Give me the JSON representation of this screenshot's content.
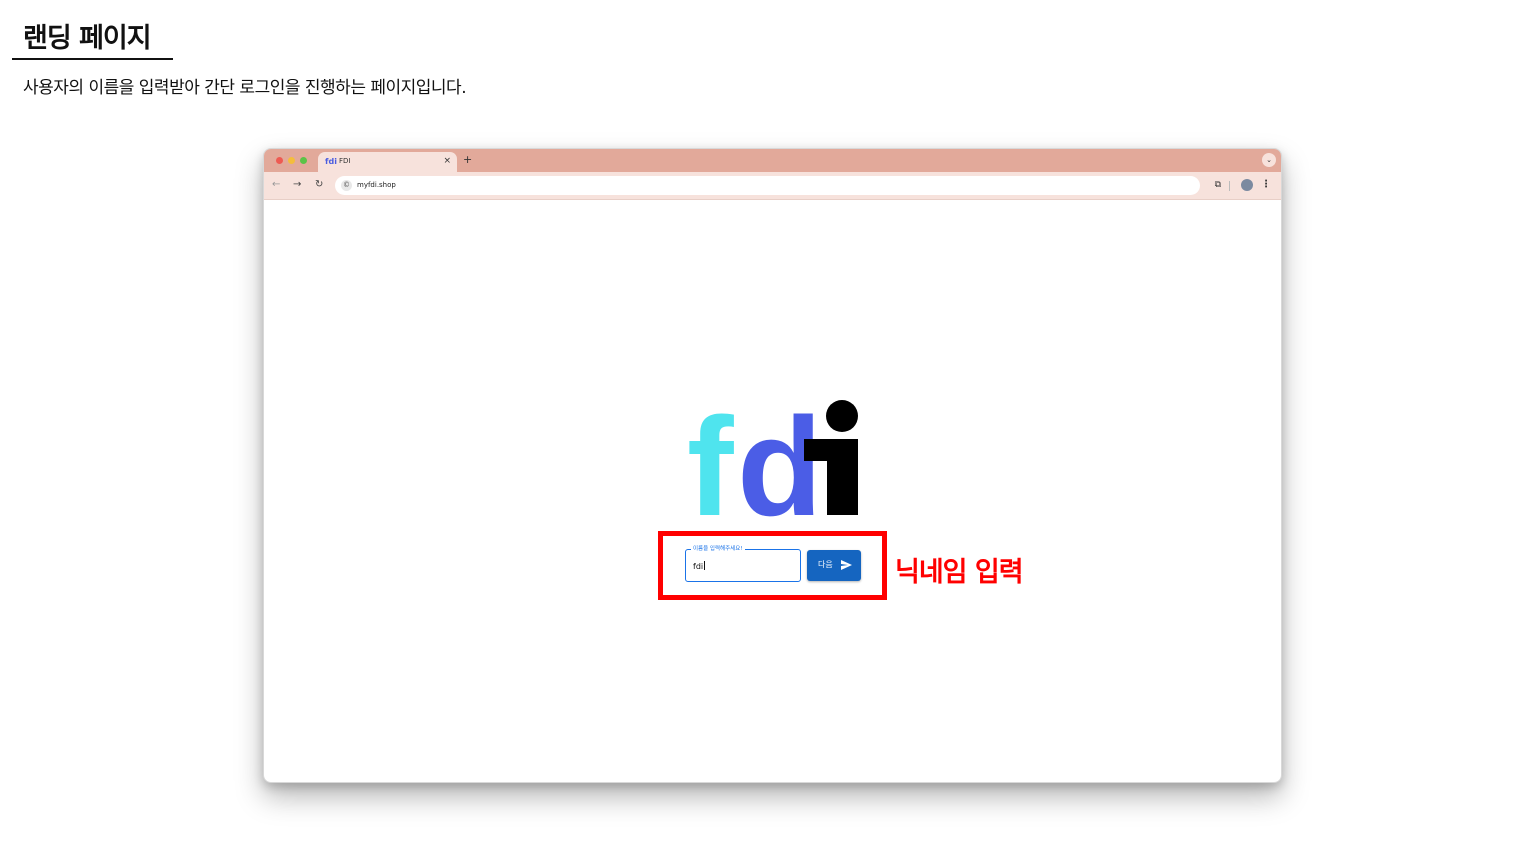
{
  "page": {
    "title": "랜딩 페이지",
    "description": "사용자의 이름을 입력받아 간단 로그인을 진행하는 페이지입니다."
  },
  "browser": {
    "tab": {
      "favicon_text": "fdi",
      "title": "FDI",
      "close": "×"
    },
    "new_tab": "+",
    "tab_menu": "⌄",
    "nav": {
      "back": "←",
      "forward": "→",
      "reload": "↻"
    },
    "url": "myfdi.shop",
    "site_icon": "©",
    "extensions_icon": "⧉",
    "menu_icon": "⋮"
  },
  "app": {
    "logo": {
      "letters": [
        "f",
        "d",
        "i"
      ],
      "colors": {
        "f": "#4fe4ee",
        "d": "#4b5de6",
        "i": "#000000"
      }
    },
    "login": {
      "label": "이름을 입력해주세요!",
      "value": "fdi",
      "button_label": "다음",
      "button_icon": "send-icon"
    }
  },
  "annotation": {
    "label": "닉네임 입력",
    "color": "#ff0000"
  }
}
